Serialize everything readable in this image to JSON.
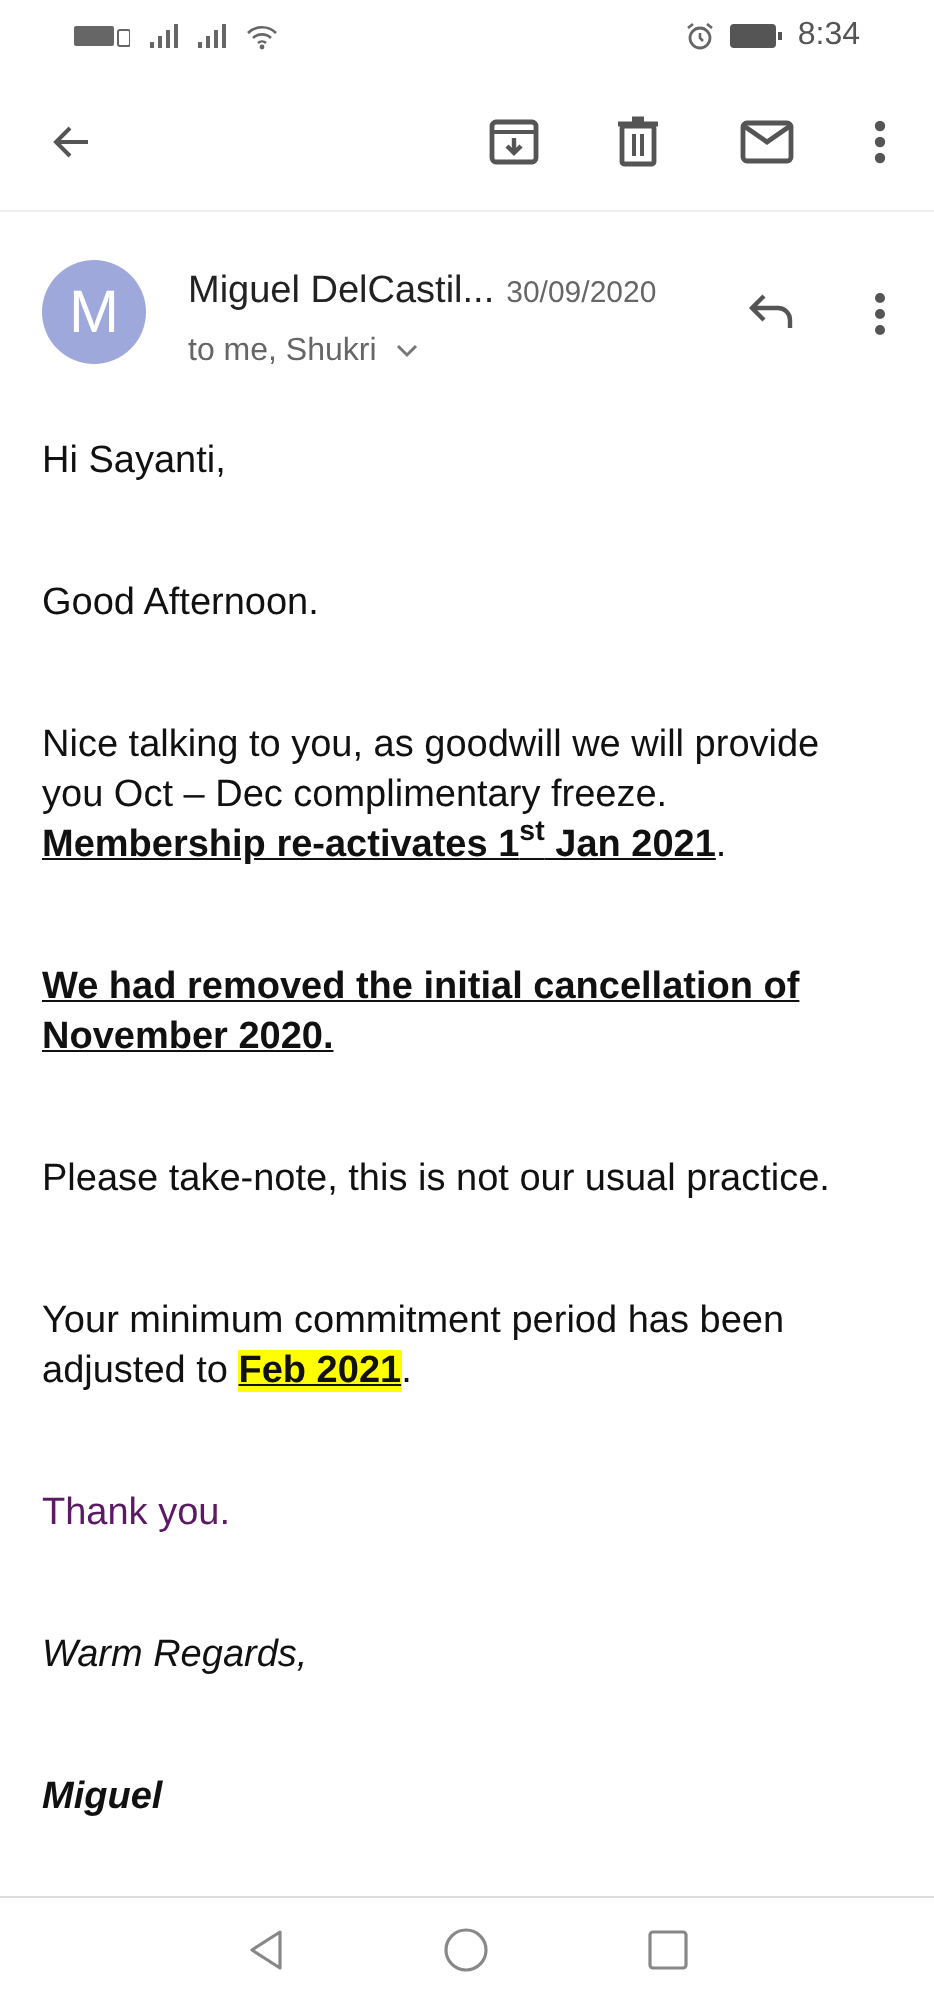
{
  "status_bar": {
    "time": "8:34"
  },
  "sender": {
    "initial": "M",
    "name": "Miguel DelCastil...",
    "date": "30/09/2020",
    "recipients": "to me, Shukri"
  },
  "body": [
    {
      "lines": [
        [
          {
            "text": "Hi Sayanti,",
            "kind": "plain"
          }
        ]
      ]
    },
    {
      "lines": [
        [
          {
            "text": "Good Afternoon.",
            "kind": "plain"
          }
        ]
      ]
    },
    {
      "lines": [
        [
          {
            "text": "Nice talking to you, as goodwill we will provide you Oct – Dec complimentary freeze.",
            "kind": "plain"
          }
        ],
        [
          {
            "text": "Membership re-activates 1$^{st}$ Jan 2021",
            "kind": "emphasis"
          },
          {
            "text": ".",
            "kind": "plain"
          }
        ]
      ]
    },
    {
      "lines": [
        [
          {
            "text": "We had removed the initial cancellation of November 2020.",
            "kind": "emphasis"
          }
        ]
      ]
    },
    {
      "lines": [
        [
          {
            "text": "Please take-note, this is not our usual practice.",
            "kind": "plain"
          }
        ]
      ]
    },
    {
      "lines": [
        [
          {
            "text": "Your minimum commitment period has been adjusted to ",
            "kind": "plain"
          },
          {
            "text": "Feb 2021",
            "kind": "highlight"
          },
          {
            "text": ".",
            "kind": "plain"
          }
        ]
      ]
    },
    {
      "lines": [
        [
          {
            "text": "Thank you.",
            "kind": "accent"
          }
        ]
      ]
    },
    {
      "lines": [
        [
          {
            "text": "Warm Regards,",
            "kind": "italic"
          }
        ]
      ]
    },
    {
      "lines": [
        [
          {
            "text": "Miguel",
            "kind": "signature"
          }
        ]
      ]
    }
  ]
}
